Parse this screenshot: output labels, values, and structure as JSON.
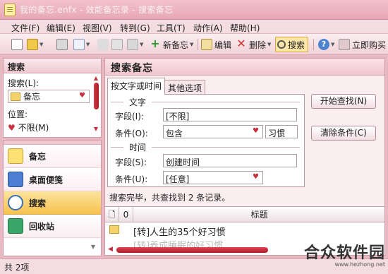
{
  "window": {
    "title": "我的备忘.enfx - 效能备忘录 - 搜索备忘"
  },
  "menu": [
    "文件(F)",
    "编辑(E)",
    "视图(V)",
    "转到(G)",
    "工具(T)",
    "动作(A)",
    "帮助(H)"
  ],
  "toolbar": {
    "new_note": "新备忘",
    "edit": "编辑",
    "delete": "删除",
    "search": "搜索",
    "buy": "立即购买"
  },
  "left_search": {
    "header": "搜索",
    "search_label": "搜索(L):",
    "search_value": "备忘",
    "position_label": "位置:",
    "position_value": "不限(M)"
  },
  "nav": {
    "items": [
      {
        "label": "备忘",
        "icon": "note-icon",
        "active": false
      },
      {
        "label": "桌面便笺",
        "icon": "sticky-note-icon",
        "active": false
      },
      {
        "label": "搜索",
        "icon": "magnifier-icon",
        "active": true
      },
      {
        "label": "回收站",
        "icon": "recycle-bin-icon",
        "active": false
      }
    ]
  },
  "search_panel": {
    "header": "搜索备忘",
    "tabs": [
      "按文字或时间",
      "其他选项"
    ],
    "text_group": "文字",
    "text_field_label": "字段(I):",
    "text_field_value": "[不限]",
    "text_cond_label": "条件(O):",
    "text_cond_value": "包含",
    "text_cond_extra": "习惯",
    "time_group": "时间",
    "time_field_label": "字段(S):",
    "time_field_value": "创建时间",
    "time_cond_label": "条件(U):",
    "time_cond_value": "[任意]",
    "start_button": "开始查找(N)",
    "clear_button": "清除条件(C)",
    "status": "搜索完毕，共查找到 2 条记录。"
  },
  "results": {
    "columns": [
      "标题"
    ],
    "rows": [
      "[转]人生的35个好习惯",
      "[转]养成睡眠的好习惯"
    ]
  },
  "statusbar": {
    "text": "共 2项"
  },
  "watermark": {
    "text": "合众软件园",
    "url": "www.hezhong.net"
  }
}
